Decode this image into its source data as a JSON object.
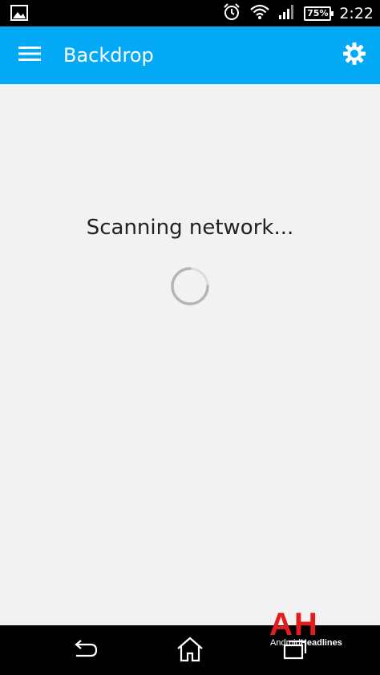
{
  "status_bar": {
    "battery": "75%",
    "time": "2:22"
  },
  "app_bar": {
    "title": "Backdrop"
  },
  "main": {
    "status_text": "Scanning network..."
  },
  "watermark": {
    "letters": "AH",
    "word1": "Android",
    "word2": "Headlines"
  },
  "colors": {
    "app_bar": "#03a9f4",
    "background": "#f2f2f2",
    "watermark": "#e11d1d"
  }
}
